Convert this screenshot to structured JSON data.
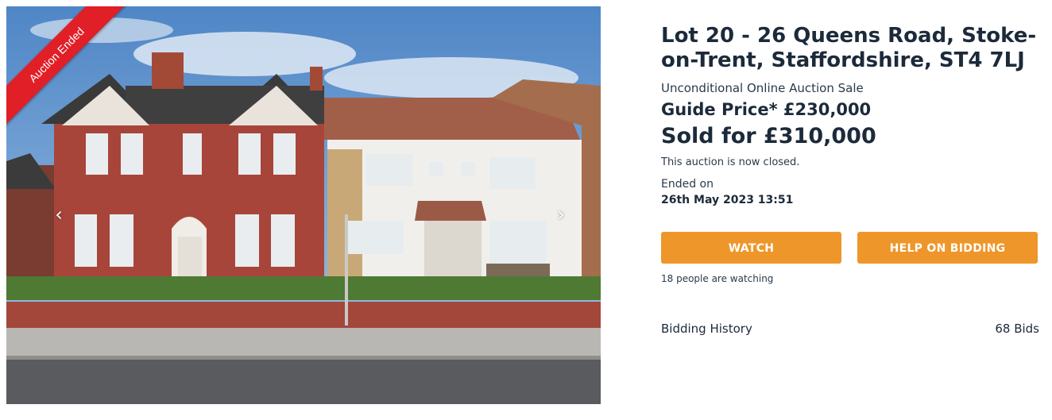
{
  "gallery": {
    "ribbon": "Auction Ended",
    "prev_arrow": "‹",
    "next_arrow": "›"
  },
  "lot": {
    "title": "Lot 20 - 26 Queens Road, Stoke-on-Trent, Staffordshire, ST4 7LJ",
    "sale_type": "Unconditional Online Auction Sale",
    "guide_price": "Guide Price* £230,000",
    "sold_price": "Sold for £310,000",
    "status": "This auction is now closed.",
    "ended_label": "Ended on",
    "ended_date": "26th May 2023 13:51"
  },
  "actions": {
    "watch_label": "WATCH",
    "help_label": "HELP ON BIDDING",
    "watching_text": "18 people are watching"
  },
  "bidding": {
    "history_label": "Bidding History",
    "bid_count": "68 Bids"
  },
  "colors": {
    "accent": "#ee962a",
    "ribbon": "#e11f26",
    "text": "#1c2a3a"
  }
}
